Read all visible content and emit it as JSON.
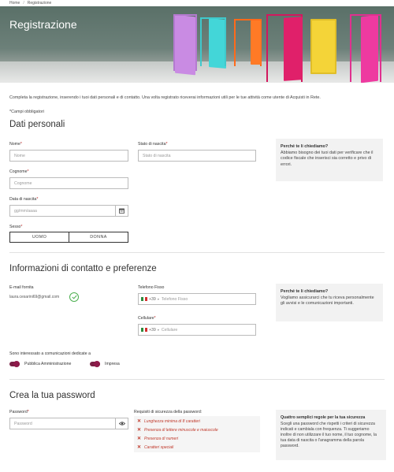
{
  "breadcrumb": {
    "home": "Home",
    "current": "Registrazione"
  },
  "hero": {
    "title": "Registrazione"
  },
  "intro": {
    "text": "Completa la registrazione, inserendo i tuoi dati personali e di contatto. Una volta registrato riceverai informazioni utili per le tue attività come utente di Acquisti in Rete.",
    "required": "*Campi obbligatori"
  },
  "personal": {
    "title": "Dati personali",
    "name_label": "Nome",
    "name_placeholder": "Nome",
    "surname_label": "Cognome",
    "surname_placeholder": "Cognome",
    "birthdate_label": "Data di nascita",
    "birthdate_placeholder": "gg/mm/aaaa",
    "birthstate_label": "Stato di nascita",
    "birthstate_placeholder": "Stato di nascita",
    "sex_label": "Sesso",
    "male": "UOMO",
    "female": "DONNA",
    "why_title": "Perché te li chiediamo?",
    "why_text": "Abbiamo bisogno dei tuoi dati per verificare che il codice fiscale che inserisci sia corretto e privo di errori."
  },
  "contact": {
    "title": "Informazioni di contatto e preferenze",
    "email_label": "E-mail fornita",
    "email_value": "laura.cesarini69@gmail.com",
    "phone_label": "Telefono Fisso",
    "phone_prefix": "+39",
    "phone_placeholder": "Telefono Fisso",
    "mobile_label": "Cellulare",
    "mobile_prefix": "+39",
    "mobile_placeholder": "Cellulare",
    "interest_label": "Sono interessato a comunicazioni dedicate a",
    "toggle_pa": "Pubblica Amministrazione",
    "toggle_impresa": "Impresa",
    "why_title": "Perché te li chiediamo?",
    "why_text": "Vogliamo assicurarci che tu riceva personalmente gli avvisi e le comunicazioni importanti."
  },
  "password": {
    "title": "Crea la tua password",
    "label": "Password",
    "placeholder": "Password",
    "req_title": "Requisiti di sicurezza della password:",
    "rules": [
      "Lunghezza minima di 8 caratteri",
      "Presenza di lettere minuscole e maiuscole",
      "Presenza di numeri",
      "Caratteri speciali"
    ],
    "tips_title": "Quattro semplici regole per la tua sicurezza",
    "tips_text": "Scegli una password che rispetti i criteri di sicurezza indicati e cambiala con frequenza. Ti suggeriamo inoltre di non utilizzare il tuo nome, il tuo cognome, la tua data di nascita o l'anagramma della parola password."
  },
  "colors": {
    "accent": "#8e1a4a",
    "error": "#c0392b",
    "ok": "#4caf50"
  }
}
